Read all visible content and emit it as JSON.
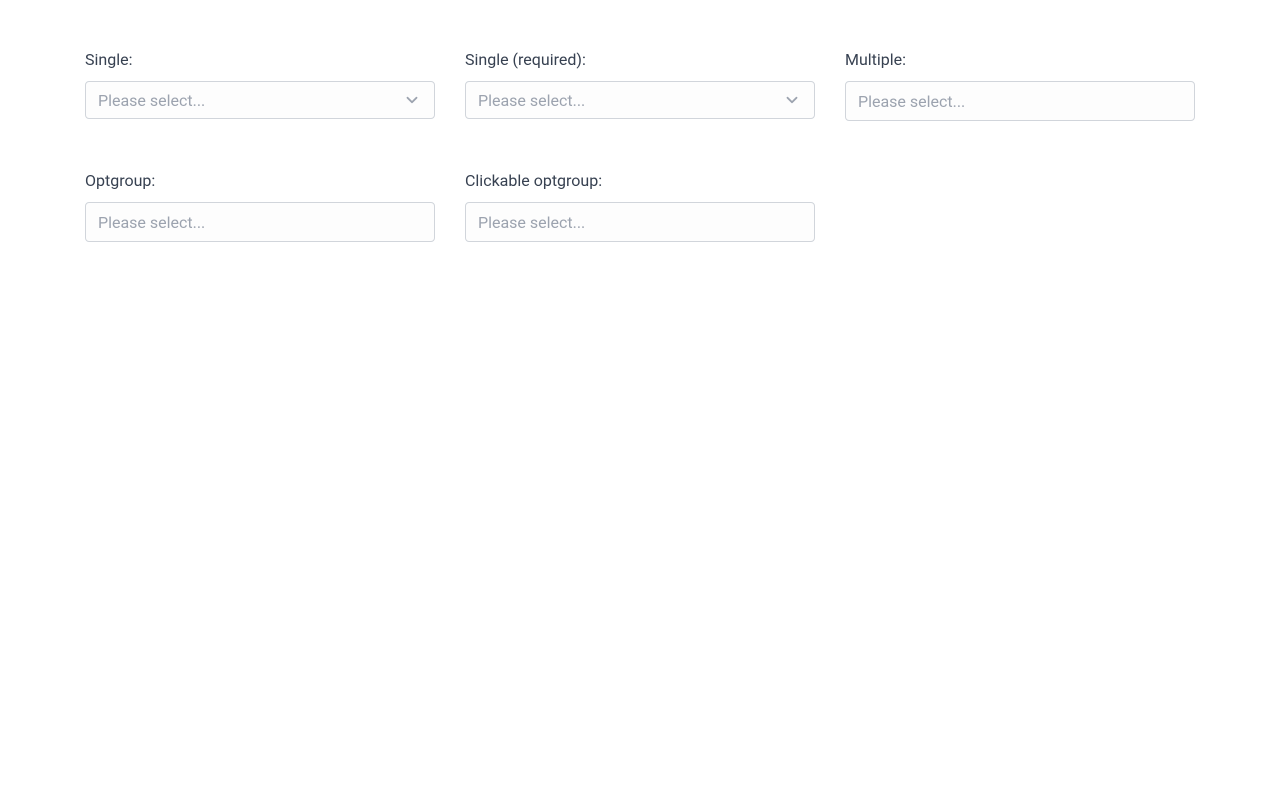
{
  "fields": {
    "single": {
      "label": "Single:",
      "placeholder": "Please select...",
      "has_chevron": true
    },
    "single_required": {
      "label": "Single (required):",
      "placeholder": "Please select...",
      "has_chevron": true
    },
    "multiple": {
      "label": "Multiple:",
      "placeholder": "Please select...",
      "has_chevron": false
    },
    "optgroup": {
      "label": "Optgroup:",
      "placeholder": "Please select...",
      "has_chevron": false
    },
    "clickable_optgroup": {
      "label": "Clickable optgroup:",
      "placeholder": "Please select...",
      "has_chevron": false
    }
  }
}
